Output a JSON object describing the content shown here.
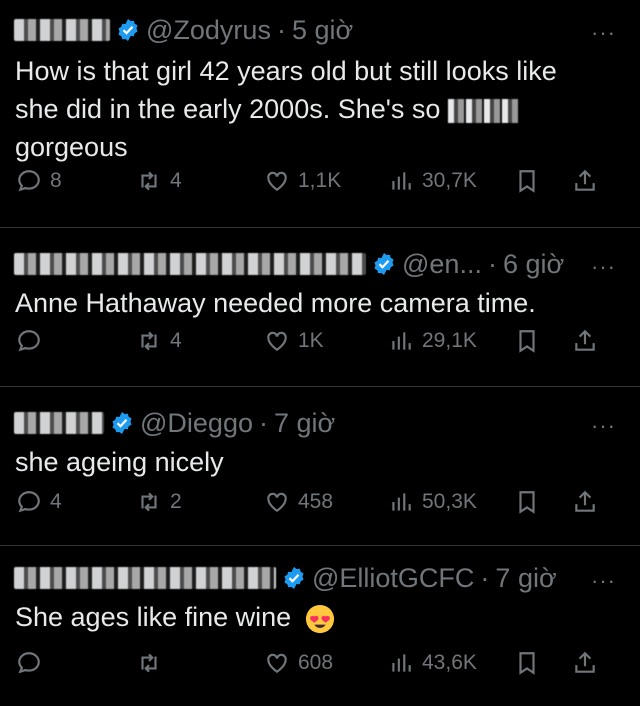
{
  "posts": [
    {
      "handle": "@Zodyrus",
      "sep": "·",
      "time": "5 giờ",
      "text_line1": "How is that girl 42 years old but still looks like",
      "text_line2_a": "she did in the early 2000s. She's so",
      "text_line3": "gorgeous",
      "replies": "8",
      "reposts": "4",
      "likes": "1,1K",
      "views": "30,7K"
    },
    {
      "handle": "@en...",
      "sep": "·",
      "time": "6 giờ",
      "text": "Anne Hathaway needed more camera time.",
      "replies": "",
      "reposts": "4",
      "likes": "1K",
      "views": "29,1K"
    },
    {
      "handle": "@Dieggo",
      "sep": "·",
      "time": "7 giờ",
      "text": "she ageing nicely",
      "replies": "4",
      "reposts": "2",
      "likes": "458",
      "views": "50,3K"
    },
    {
      "handle": "@ElliotGCFC",
      "sep": "·",
      "time": "7 giờ",
      "text": "She ages like fine wine",
      "replies": "",
      "reposts": "",
      "likes": "608",
      "views": "43,6K"
    }
  ],
  "more_label": "···",
  "colors": {
    "background": "#000000",
    "text": "#e7e9ea",
    "muted": "#71767b",
    "verified": "#1d9bf0",
    "divider": "#2f3336"
  }
}
